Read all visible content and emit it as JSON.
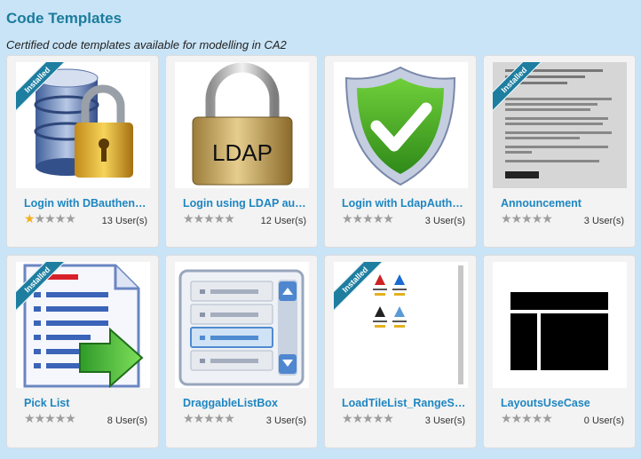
{
  "page": {
    "title": "Code Templates",
    "subtitle": "Certified code templates available for modelling in CA2"
  },
  "badge_label": "Installed",
  "colors": {
    "accent": "#1b7c9c",
    "link": "#1e86c1",
    "star_on": "#f2b01e",
    "star_off": "#9e9e9e"
  },
  "cards": [
    {
      "title": "Login with DBauthenti...",
      "rating": 1,
      "max_rating": 5,
      "users": "13 User(s)",
      "installed": true,
      "icon": "database-lock-icon"
    },
    {
      "title": "Login using LDAP auth...",
      "rating": 0,
      "max_rating": 5,
      "users": "12 User(s)",
      "installed": false,
      "icon": "ldap-padlock-icon",
      "icon_text": "LDAP"
    },
    {
      "title": "Login with LdapAuthe...",
      "rating": 0,
      "max_rating": 5,
      "users": "3 User(s)",
      "installed": false,
      "icon": "shield-check-icon"
    },
    {
      "title": "Announcement",
      "rating": 0,
      "max_rating": 5,
      "users": "3 User(s)",
      "installed": true,
      "icon": "announcement-thumbnail"
    },
    {
      "title": "Pick List",
      "rating": 0,
      "max_rating": 5,
      "users": "8 User(s)",
      "installed": true,
      "icon": "pick-list-icon"
    },
    {
      "title": "DraggableListBox",
      "rating": 0,
      "max_rating": 5,
      "users": "3 User(s)",
      "installed": false,
      "icon": "list-box-icon"
    },
    {
      "title": "LoadTileList_RangeSe...",
      "rating": 0,
      "max_rating": 5,
      "users": "3 User(s)",
      "installed": true,
      "icon": "tile-list-thumbnail"
    },
    {
      "title": "LayoutsUseCase",
      "rating": 0,
      "max_rating": 5,
      "users": "0 User(s)",
      "installed": false,
      "icon": "layout-icon"
    }
  ]
}
